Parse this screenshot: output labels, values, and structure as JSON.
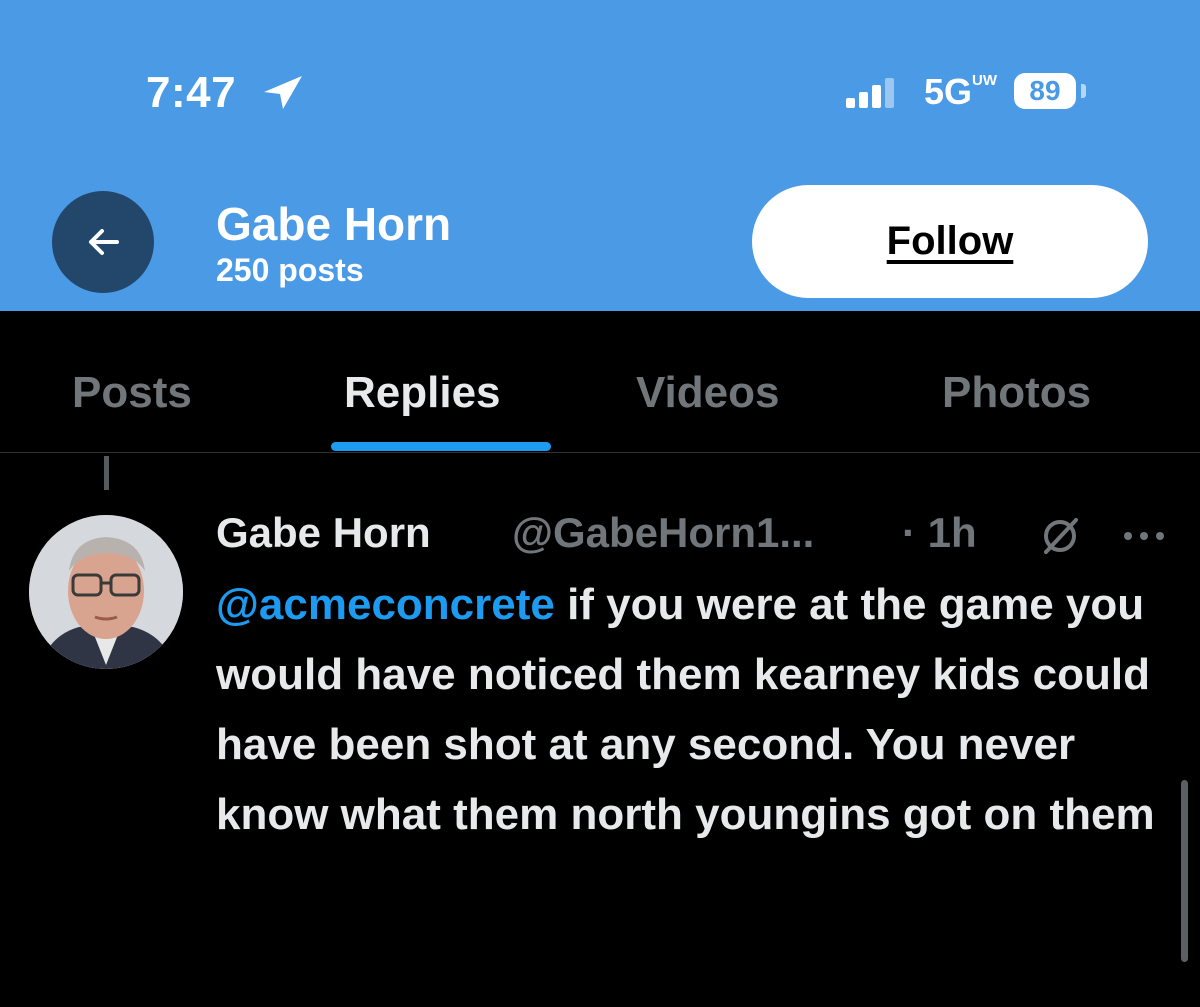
{
  "status_bar": {
    "time": "7:47",
    "network": "5G",
    "network_suffix": "UW",
    "battery": "89",
    "icons": [
      "location-arrow-icon",
      "signal-bars-icon",
      "battery-icon"
    ]
  },
  "header": {
    "name": "Gabe Horn",
    "post_count": "250 posts",
    "follow_label": "Follow",
    "back_icon": "back-arrow-icon",
    "bg_color": "#4b9ae6"
  },
  "tabs": [
    {
      "label": "Posts",
      "active": false
    },
    {
      "label": "Replies",
      "active": true
    },
    {
      "label": "Videos",
      "active": false
    },
    {
      "label": "Photos",
      "active": false
    }
  ],
  "tweet": {
    "author": "Gabe Horn",
    "handle": "@GabeHorn1...",
    "time": "· 1h",
    "mention": "@acmeconcrete",
    "text": " if you were at the game you would have noticed them kearney kids could have been shot at any second. You never know what them north youngins got on them",
    "icons": [
      "grok-icon",
      "more-icon"
    ]
  },
  "colors": {
    "accent": "#1d9bf0",
    "muted": "#71767b",
    "text": "#e7e9ea",
    "background": "#000000"
  }
}
